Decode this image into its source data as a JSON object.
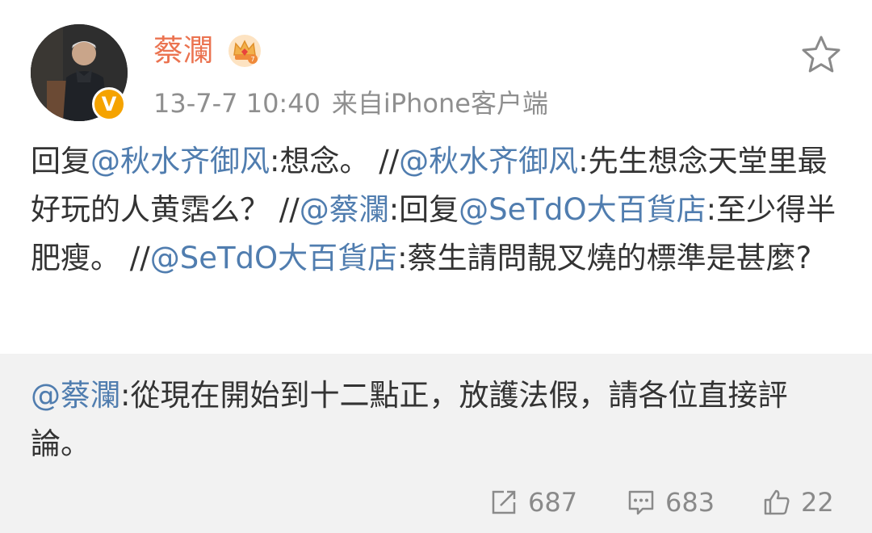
{
  "user": {
    "name": "蔡瀾",
    "verified_badge": "V",
    "time": "13-7-7 10:40",
    "source": "来自iPhone客户端"
  },
  "post": {
    "seg1": "回复",
    "mention1": "@秋水齐御风",
    "seg2": ":想念。 //",
    "mention2": "@秋水齐御风",
    "seg3": ":先生想念天堂里最好玩的人黄霑么？ //",
    "mention3": "@蔡瀾",
    "seg4": ":回复",
    "mention4": "@SeTdO大百貨店",
    "seg5": ":至少得半肥瘦。 //",
    "mention5": "@SeTdO大百貨店",
    "seg6": ":蔡生請問靚叉燒的標準是甚麼?"
  },
  "reply": {
    "mention": "@蔡瀾",
    "text": ":從現在開始到十二點正，放護法假，請各位直接評論。"
  },
  "actions": {
    "repost_count": "687",
    "comment_count": "683",
    "like_count": "22"
  },
  "colors": {
    "username": "#eb7350",
    "mention": "#507daf",
    "verified": "#f5a300",
    "reply_bg": "#f2f2f2"
  },
  "icons": [
    "crown-icon",
    "star-icon",
    "verified-icon",
    "repost-icon",
    "comment-icon",
    "like-icon"
  ]
}
